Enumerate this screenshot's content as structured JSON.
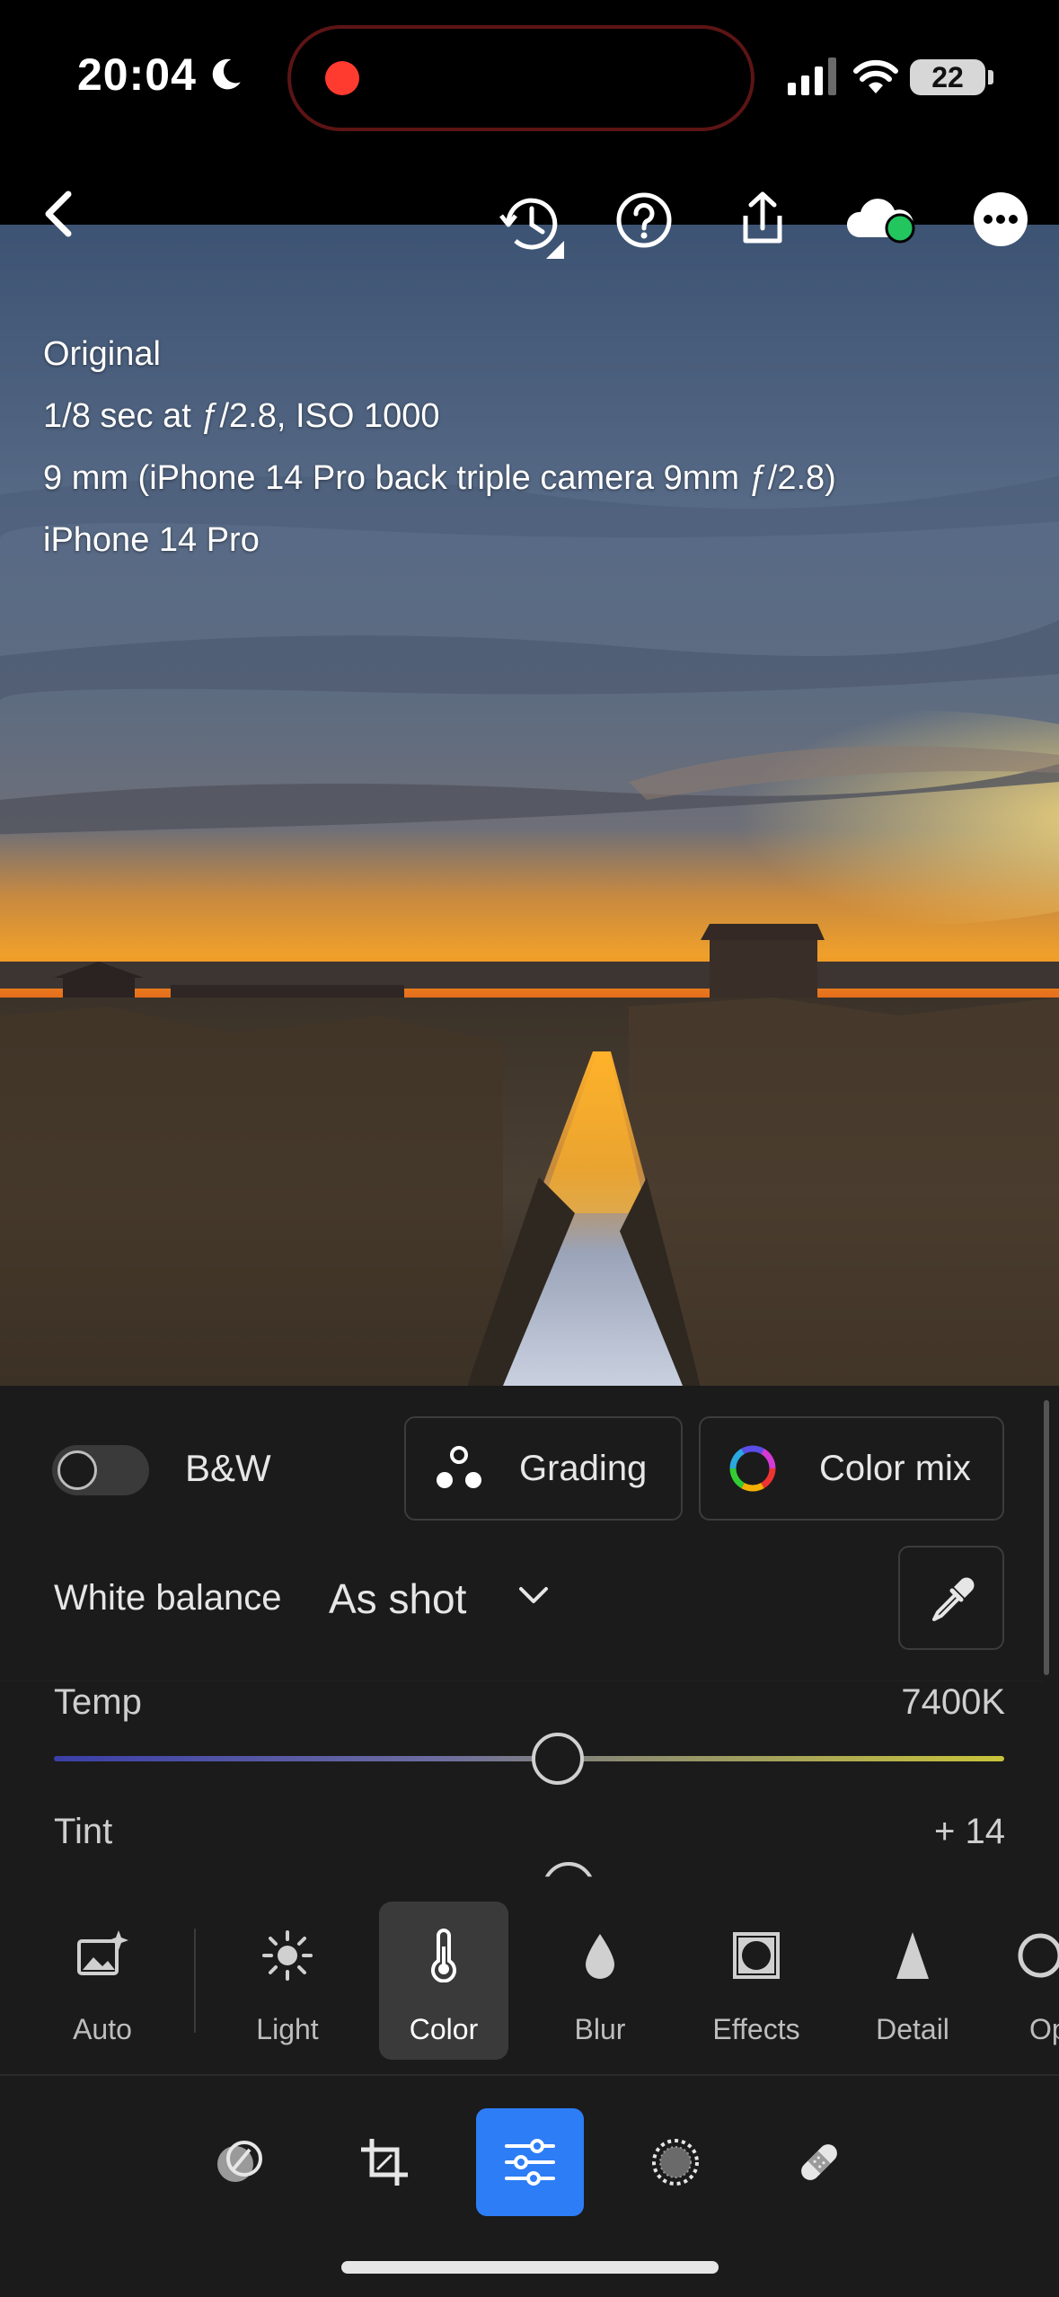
{
  "status_bar": {
    "time": "20:04",
    "battery": "22"
  },
  "photo_info": {
    "lines": [
      "Original",
      "1/8 sec at ƒ/2.8, ISO 1000",
      "9 mm (iPhone 14 Pro back triple camera 9mm ƒ/2.8)",
      "iPhone 14 Pro"
    ]
  },
  "top_bar": {
    "icons": [
      "back-icon",
      "history-icon",
      "help-icon",
      "share-icon",
      "cloud-sync-icon",
      "more-icon"
    ],
    "sync_status_color": "#22c55e"
  },
  "color_panel": {
    "bw_label": "B&W",
    "bw_enabled": false,
    "grading_label": "Grading",
    "color_mix_label": "Color mix",
    "white_balance_label": "White balance",
    "white_balance_value": "As shot",
    "temp_label": "Temp",
    "temp_value": "7400K",
    "temp_level": 0.53,
    "tint_label": "Tint",
    "tint_value": "+ 14"
  },
  "tools": [
    {
      "label": "Auto",
      "icon": "auto-enhance-icon"
    },
    {
      "label": "Light",
      "icon": "sun-icon"
    },
    {
      "label": "Color",
      "icon": "thermometer-icon",
      "selected": true
    },
    {
      "label": "Blur",
      "icon": "drop-icon"
    },
    {
      "label": "Effects",
      "icon": "vignette-icon"
    },
    {
      "label": "Detail",
      "icon": "triangle-icon"
    },
    {
      "label": "Op",
      "icon": "optics-icon"
    }
  ],
  "modes": [
    {
      "icon": "presets-icon"
    },
    {
      "icon": "crop-icon"
    },
    {
      "icon": "edit-sliders-icon",
      "selected": true
    },
    {
      "icon": "masking-icon"
    },
    {
      "icon": "healing-icon"
    }
  ],
  "accent_color": "#2d7df6"
}
